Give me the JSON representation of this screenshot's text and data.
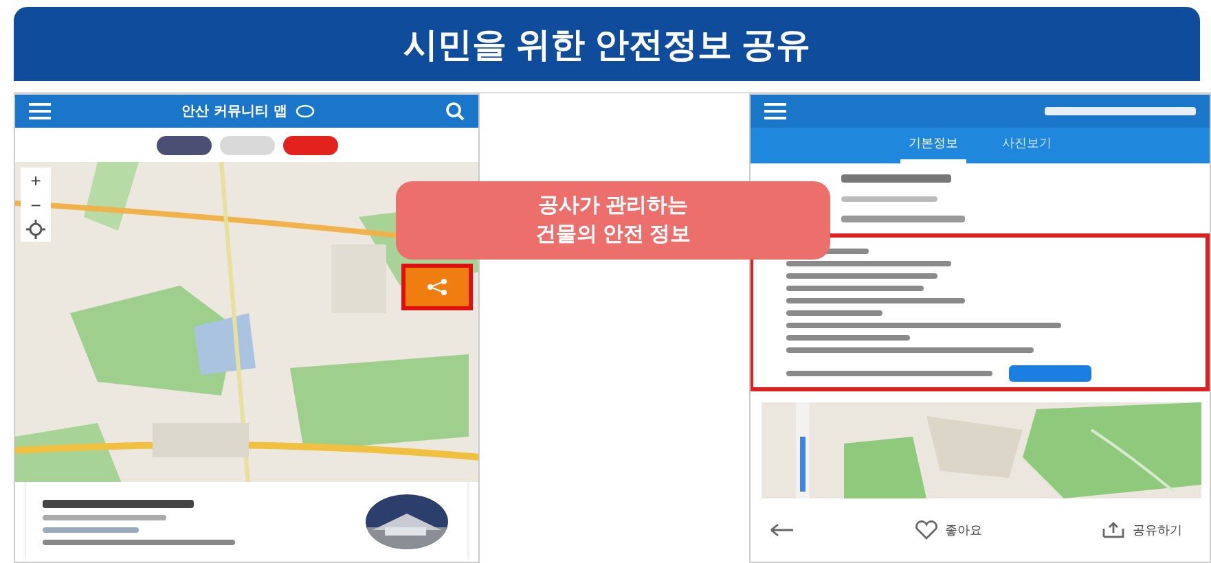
{
  "title": "시민을 위한 안전정보 공유",
  "callout": {
    "lines": [
      "공사가 관리하는",
      "건물의 안전 정보"
    ]
  },
  "left_screen": {
    "header": {
      "title": "안산 커뮤니티 맵"
    },
    "filters": [
      {
        "color": "#4b4f74"
      },
      {
        "color": "#d9d9d9"
      },
      {
        "color": "#e3211d"
      }
    ],
    "zoom_controls": [
      "+",
      "−"
    ],
    "map_button": {
      "highlighted": true
    },
    "card": {
      "thumbnail": {
        "kind": "picture"
      }
    }
  },
  "right_screen": {
    "tabs": [
      {
        "label": "기본정보",
        "selected": true
      },
      {
        "label": "사진보기",
        "selected": false
      }
    ],
    "info_box": {
      "highlighted": true
    },
    "actions": [
      {
        "label": "좋아요"
      },
      {
        "label": "공유하기"
      }
    ]
  }
}
